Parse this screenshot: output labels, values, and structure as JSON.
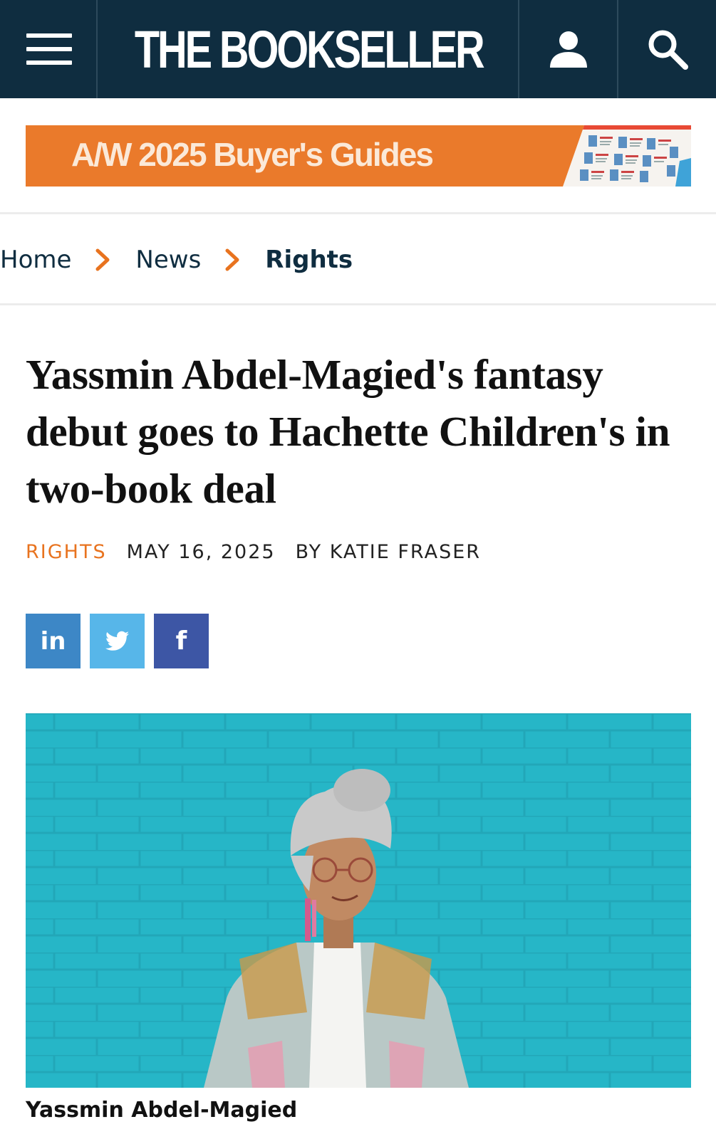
{
  "header": {
    "logo_text": "THE BOOKSELLER",
    "background_color": "#0f2d40",
    "icons": [
      "menu-icon",
      "user-icon",
      "search-icon"
    ]
  },
  "promo_banner": {
    "text": "A/W 2025 Buyer's Guides",
    "background_color": "#ea7a2b"
  },
  "breadcrumb": {
    "items": [
      {
        "label": "Home"
      },
      {
        "label": "News"
      },
      {
        "label": "Rights"
      }
    ],
    "separator_icon": "chevron-right-icon",
    "separator_color": "#e8731f"
  },
  "article": {
    "title": "Yassmin Abdel-Magied's fantasy debut goes to Hachette Children's in two-book deal",
    "category": "RIGHTS",
    "date": "MAY 16, 2025",
    "byline": "BY KATIE FRASER",
    "accent_color": "#e8731f",
    "share": {
      "linkedin_label": "in",
      "twitter_icon": "twitter-bird-icon",
      "facebook_label": "f"
    },
    "image": {
      "subject": "portrait-photo",
      "background_color": "#25b3c4"
    },
    "caption": "Yassmin Abdel-Magied"
  }
}
